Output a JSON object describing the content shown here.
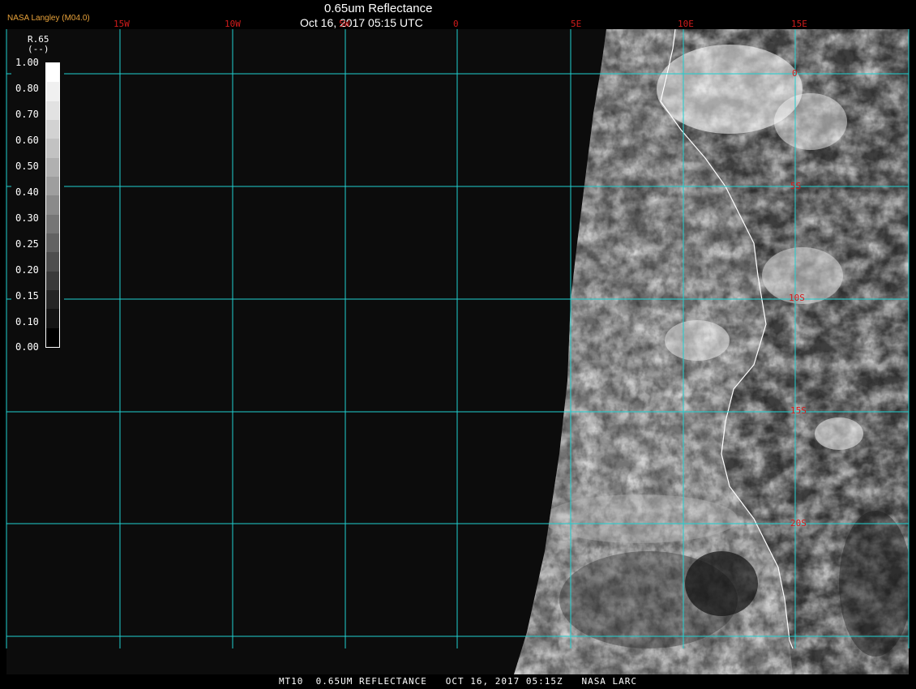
{
  "header": {
    "title": "0.65um Reflectance",
    "datetime": "Oct 16, 2017 05:15 UTC",
    "agency": "NASA Langley (M04.0)"
  },
  "footer": {
    "caption": "MT10  0.65UM REFLECTANCE   OCT 16, 2017 05:15Z   NASA LARC"
  },
  "legend": {
    "title": "R.65",
    "unit": "(--)",
    "ticks": [
      "1.00",
      "0.80",
      "0.70",
      "0.60",
      "0.50",
      "0.40",
      "0.30",
      "0.25",
      "0.20",
      "0.15",
      "0.10",
      "0.00"
    ],
    "swatches": [
      "#ffffff",
      "#f0f0f0",
      "#e2e2e2",
      "#d2d2d2",
      "#c2c2c2",
      "#b0b0b0",
      "#9e9e9e",
      "#8a8a8a",
      "#767676",
      "#626262",
      "#4e4e4e",
      "#3a3a3a",
      "#262626",
      "#141414",
      "#000000"
    ]
  },
  "grid": {
    "color": "#20d0d0",
    "label_color": "#d21c1c",
    "longitudes": [
      "15W",
      "10W",
      "5W",
      "0",
      "5E",
      "10E",
      "15E"
    ],
    "latitudes": [
      "0",
      "5S",
      "10S",
      "15S",
      "20S"
    ]
  },
  "colors": {
    "background": "#000000",
    "space": "#0c0c0c",
    "coastline": "#ffffff"
  }
}
